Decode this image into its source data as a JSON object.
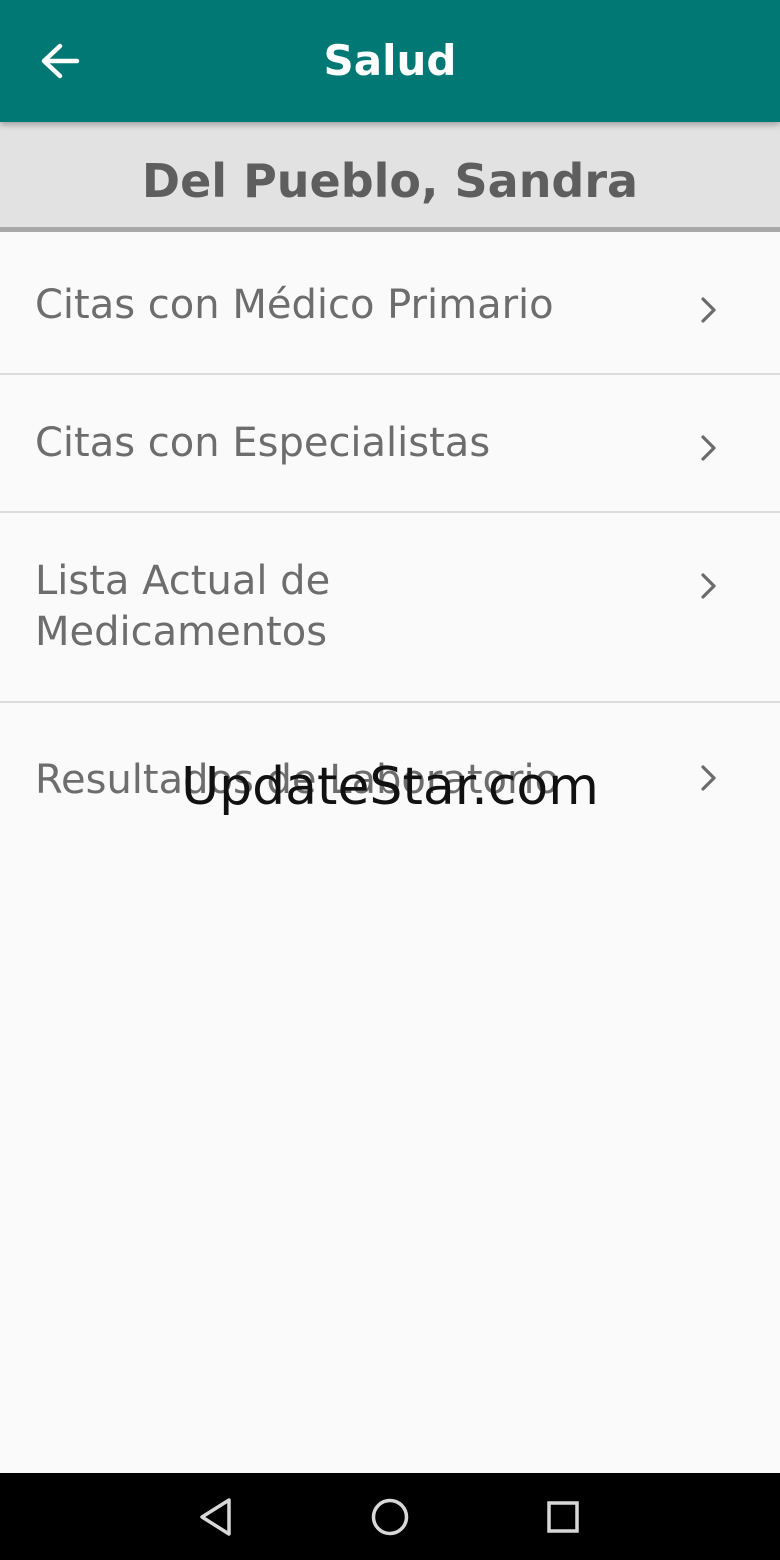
{
  "app_bar": {
    "title": "Salud",
    "back_icon": "arrow-left-icon",
    "background": "#017873"
  },
  "patient": {
    "name": "Del Pueblo, Sandra"
  },
  "menu": {
    "items": [
      {
        "label": "Citas con Médico Primario",
        "icon": "chevron-right-icon"
      },
      {
        "label": "Citas con Especialistas",
        "icon": "chevron-right-icon"
      },
      {
        "label": "Lista Actual de Medicamentos",
        "icon": "chevron-right-icon"
      },
      {
        "label": "Resultados de Laboratorio",
        "icon": "chevron-right-icon"
      }
    ]
  },
  "watermark": "UpdateStar.com",
  "nav_bar": {
    "back_icon": "triangle-back-icon",
    "home_icon": "circle-home-icon",
    "recents_icon": "square-recents-icon"
  }
}
